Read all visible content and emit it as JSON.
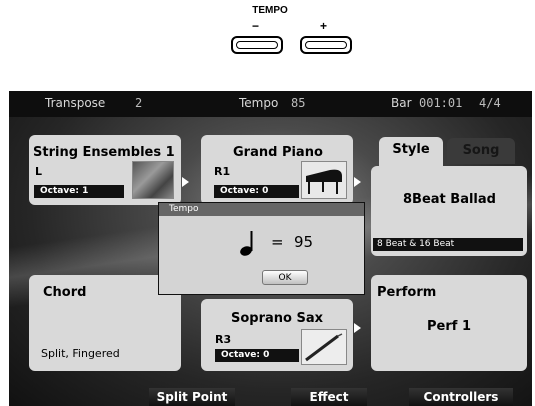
{
  "hardware": {
    "title": "TEMPO",
    "minus_label": "−",
    "plus_label": "+"
  },
  "status_bar": {
    "transpose_label": "Transpose",
    "transpose_value": "2",
    "tempo_label": "Tempo",
    "tempo_value": "85",
    "bar_label": "Bar",
    "bar_value": "001:01",
    "time_signature": "4/4"
  },
  "parts": {
    "left": {
      "name": "String Ensembles 1",
      "part": "L",
      "octave": "Octave: 1"
    },
    "right1": {
      "name": "Grand Piano",
      "part": "R1",
      "octave": "Octave: 0"
    },
    "right3": {
      "name": "Soprano Sax",
      "part": "R3",
      "octave": "Octave: 0"
    }
  },
  "style_panel": {
    "tab_style": "Style",
    "tab_song": "Song",
    "style_name": "8Beat Ballad",
    "category": "8 Beat & 16 Beat"
  },
  "chord_panel": {
    "title": "Chord",
    "mode": "Split, Fingered"
  },
  "perform_panel": {
    "title": "Perform",
    "value": "Perf 1"
  },
  "softkeys": {
    "split_point": "Split Point",
    "effect": "Effect",
    "controllers": "Controllers"
  },
  "tempo_dialog": {
    "title": "Tempo",
    "equals": "=",
    "value": "95",
    "ok_label": "OK"
  }
}
